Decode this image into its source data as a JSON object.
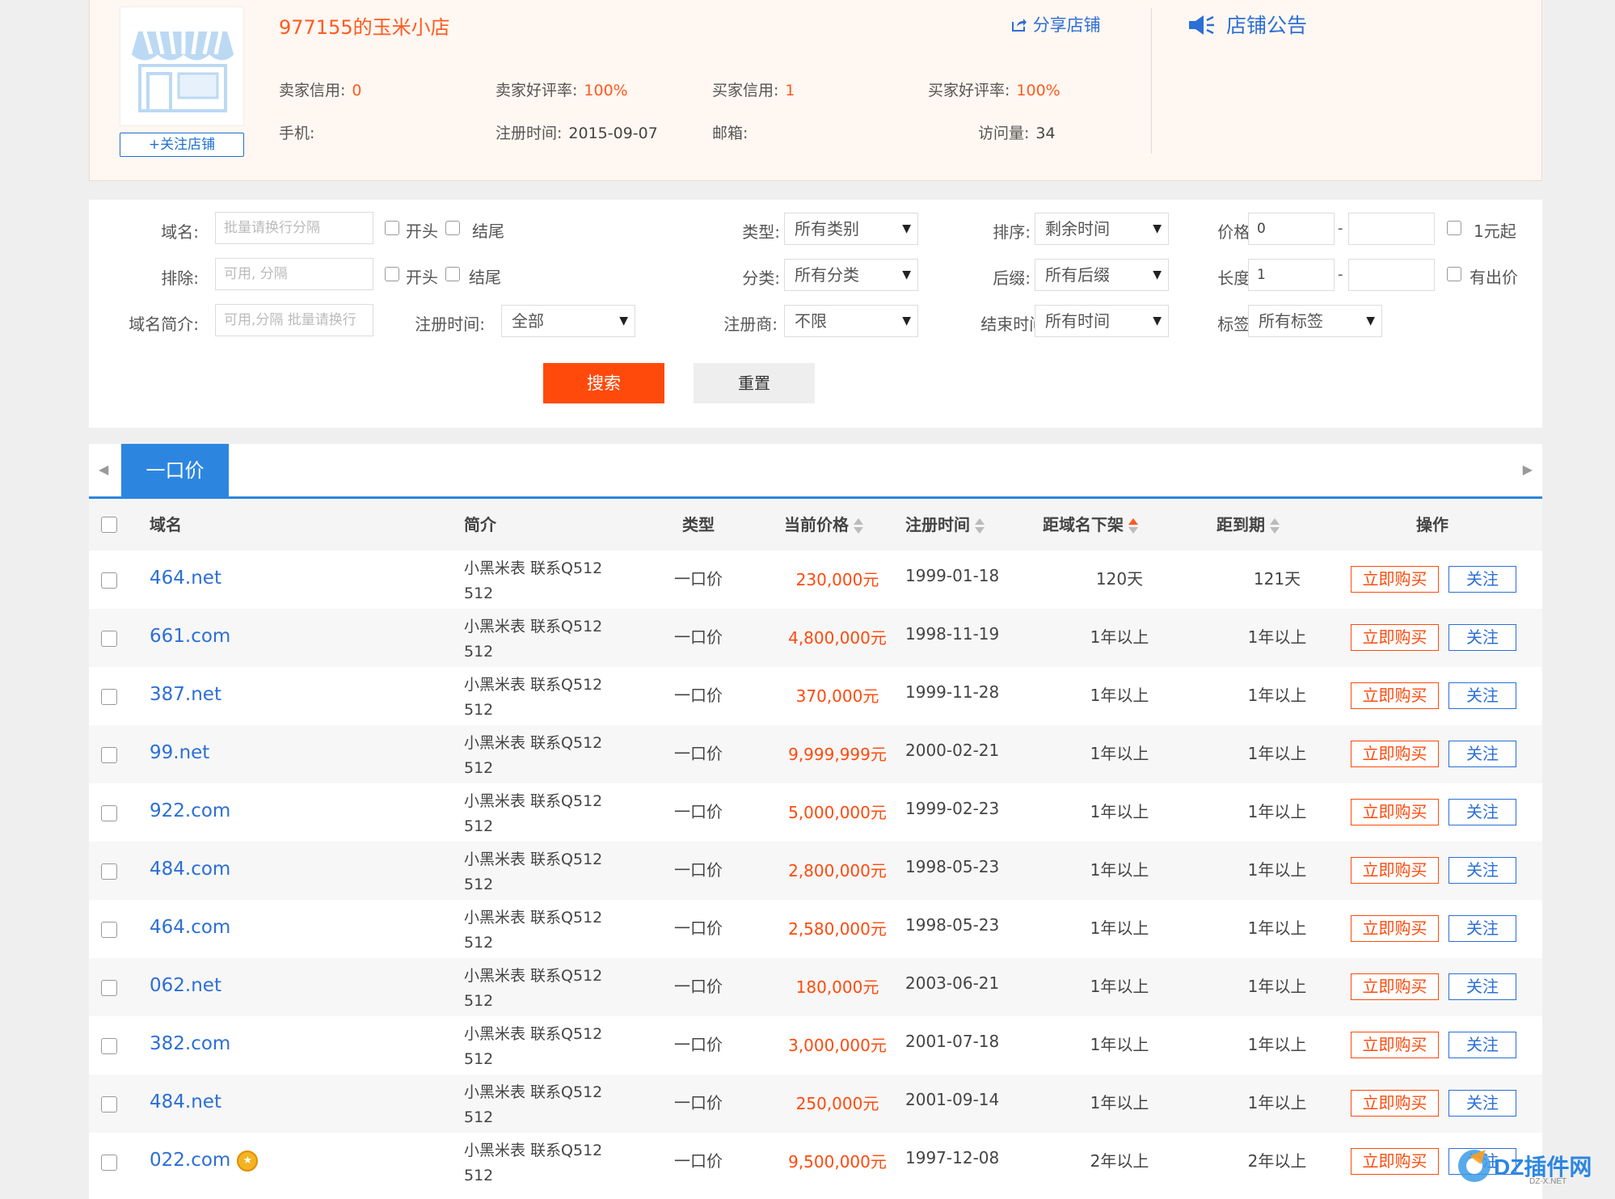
{
  "store": {
    "name": "977155的玉米小店",
    "follow_label": "+关注店铺",
    "share_label": "分享店铺",
    "notice_label": "店铺公告",
    "seller_credit_label": "卖家信用:",
    "seller_credit": "0",
    "seller_rate_label": "卖家好评率:",
    "seller_rate": "100%",
    "buyer_credit_label": "买家信用:",
    "buyer_credit": "1",
    "buyer_rate_label": "买家好评率:",
    "buyer_rate": "100%",
    "phone_label": "手机:",
    "reg_label": "注册时间:",
    "reg_date": "2015-09-07",
    "email_label": "邮箱:",
    "visits_label": "访问量:",
    "visits": "34"
  },
  "filters": {
    "domain_label": "域名:",
    "domain_placeholder": "批量请换行分隔",
    "exclude_label": "排除:",
    "exclude_placeholder": "可用, 分隔",
    "intro_label": "域名简介:",
    "intro_placeholder": "可用,分隔 批量请换行",
    "start_label": "开头",
    "end_label": "结尾",
    "reg_time_label": "注册时间:",
    "reg_time_value": "全部",
    "type_label": "类型:",
    "type_value": "所有类别",
    "category_label": "分类:",
    "category_value": "所有分类",
    "registrar_label": "注册商:",
    "registrar_value": "不限",
    "sort_label": "排序:",
    "sort_value": "剩余时间",
    "suffix_label": "后缀:",
    "suffix_value": "所有后缀",
    "end_time_label": "结束时间:",
    "end_time_value": "所有时间",
    "price_label": "价格:",
    "price_min": "0",
    "price_max": "",
    "one_yuan_label": "1元起",
    "length_label": "长度:",
    "length_min": "1",
    "length_max": "",
    "has_bid_label": "有出价",
    "tag_label": "标签:",
    "tag_value": "所有标签",
    "dash": "-",
    "search_label": "搜索",
    "reset_label": "重置"
  },
  "tabs": {
    "active": "一口价"
  },
  "table": {
    "headers": {
      "domain": "域名",
      "intro": "简介",
      "type": "类型",
      "price": "当前价格",
      "reg": "注册时间",
      "down": "距域名下架",
      "exp": "距到期",
      "ops": "操作"
    },
    "buy_label": "立即购买",
    "fav_label": "关注",
    "rows": [
      {
        "domain": "464.net",
        "intro1": "小黑米表 联系Q512",
        "intro2": "512",
        "type": "一口价",
        "price": "230,000元",
        "reg": "1999-01-18",
        "down": "120天",
        "exp": "121天"
      },
      {
        "domain": "661.com",
        "intro1": "小黑米表 联系Q512",
        "intro2": "512",
        "type": "一口价",
        "price": "4,800,000元",
        "reg": "1998-11-19",
        "down": "1年以上",
        "exp": "1年以上"
      },
      {
        "domain": "387.net",
        "intro1": "小黑米表 联系Q512",
        "intro2": "512",
        "type": "一口价",
        "price": "370,000元",
        "reg": "1999-11-28",
        "down": "1年以上",
        "exp": "1年以上"
      },
      {
        "domain": "99.net",
        "intro1": "小黑米表 联系Q512",
        "intro2": "512",
        "type": "一口价",
        "price": "9,999,999元",
        "reg": "2000-02-21",
        "down": "1年以上",
        "exp": "1年以上"
      },
      {
        "domain": "922.com",
        "intro1": "小黑米表 联系Q512",
        "intro2": "512",
        "type": "一口价",
        "price": "5,000,000元",
        "reg": "1999-02-23",
        "down": "1年以上",
        "exp": "1年以上"
      },
      {
        "domain": "484.com",
        "intro1": "小黑米表 联系Q512",
        "intro2": "512",
        "type": "一口价",
        "price": "2,800,000元",
        "reg": "1998-05-23",
        "down": "1年以上",
        "exp": "1年以上"
      },
      {
        "domain": "464.com",
        "intro1": "小黑米表 联系Q512",
        "intro2": "512",
        "type": "一口价",
        "price": "2,580,000元",
        "reg": "1998-05-23",
        "down": "1年以上",
        "exp": "1年以上"
      },
      {
        "domain": "062.net",
        "intro1": "小黑米表 联系Q512",
        "intro2": "512",
        "type": "一口价",
        "price": "180,000元",
        "reg": "2003-06-21",
        "down": "1年以上",
        "exp": "1年以上"
      },
      {
        "domain": "382.com",
        "intro1": "小黑米表 联系Q512",
        "intro2": "512",
        "type": "一口价",
        "price": "3,000,000元",
        "reg": "2001-07-18",
        "down": "1年以上",
        "exp": "1年以上"
      },
      {
        "domain": "484.net",
        "intro1": "小黑米表 联系Q512",
        "intro2": "512",
        "type": "一口价",
        "price": "250,000元",
        "reg": "2001-09-14",
        "down": "1年以上",
        "exp": "1年以上"
      },
      {
        "domain": "022.com",
        "intro1": "小黑米表 联系Q512",
        "intro2": "512",
        "type": "一口价",
        "price": "9,500,000元",
        "reg": "1997-12-08",
        "down": "2年以上",
        "exp": "2年以上"
      }
    ]
  },
  "watermark": {
    "main": "DZ插件网",
    "sub": "DZ-X.NET"
  },
  "colors": {
    "accent_orange": "#ff4a0c",
    "link_blue": "#2c6fd6",
    "tab_blue": "#2c86e0"
  }
}
